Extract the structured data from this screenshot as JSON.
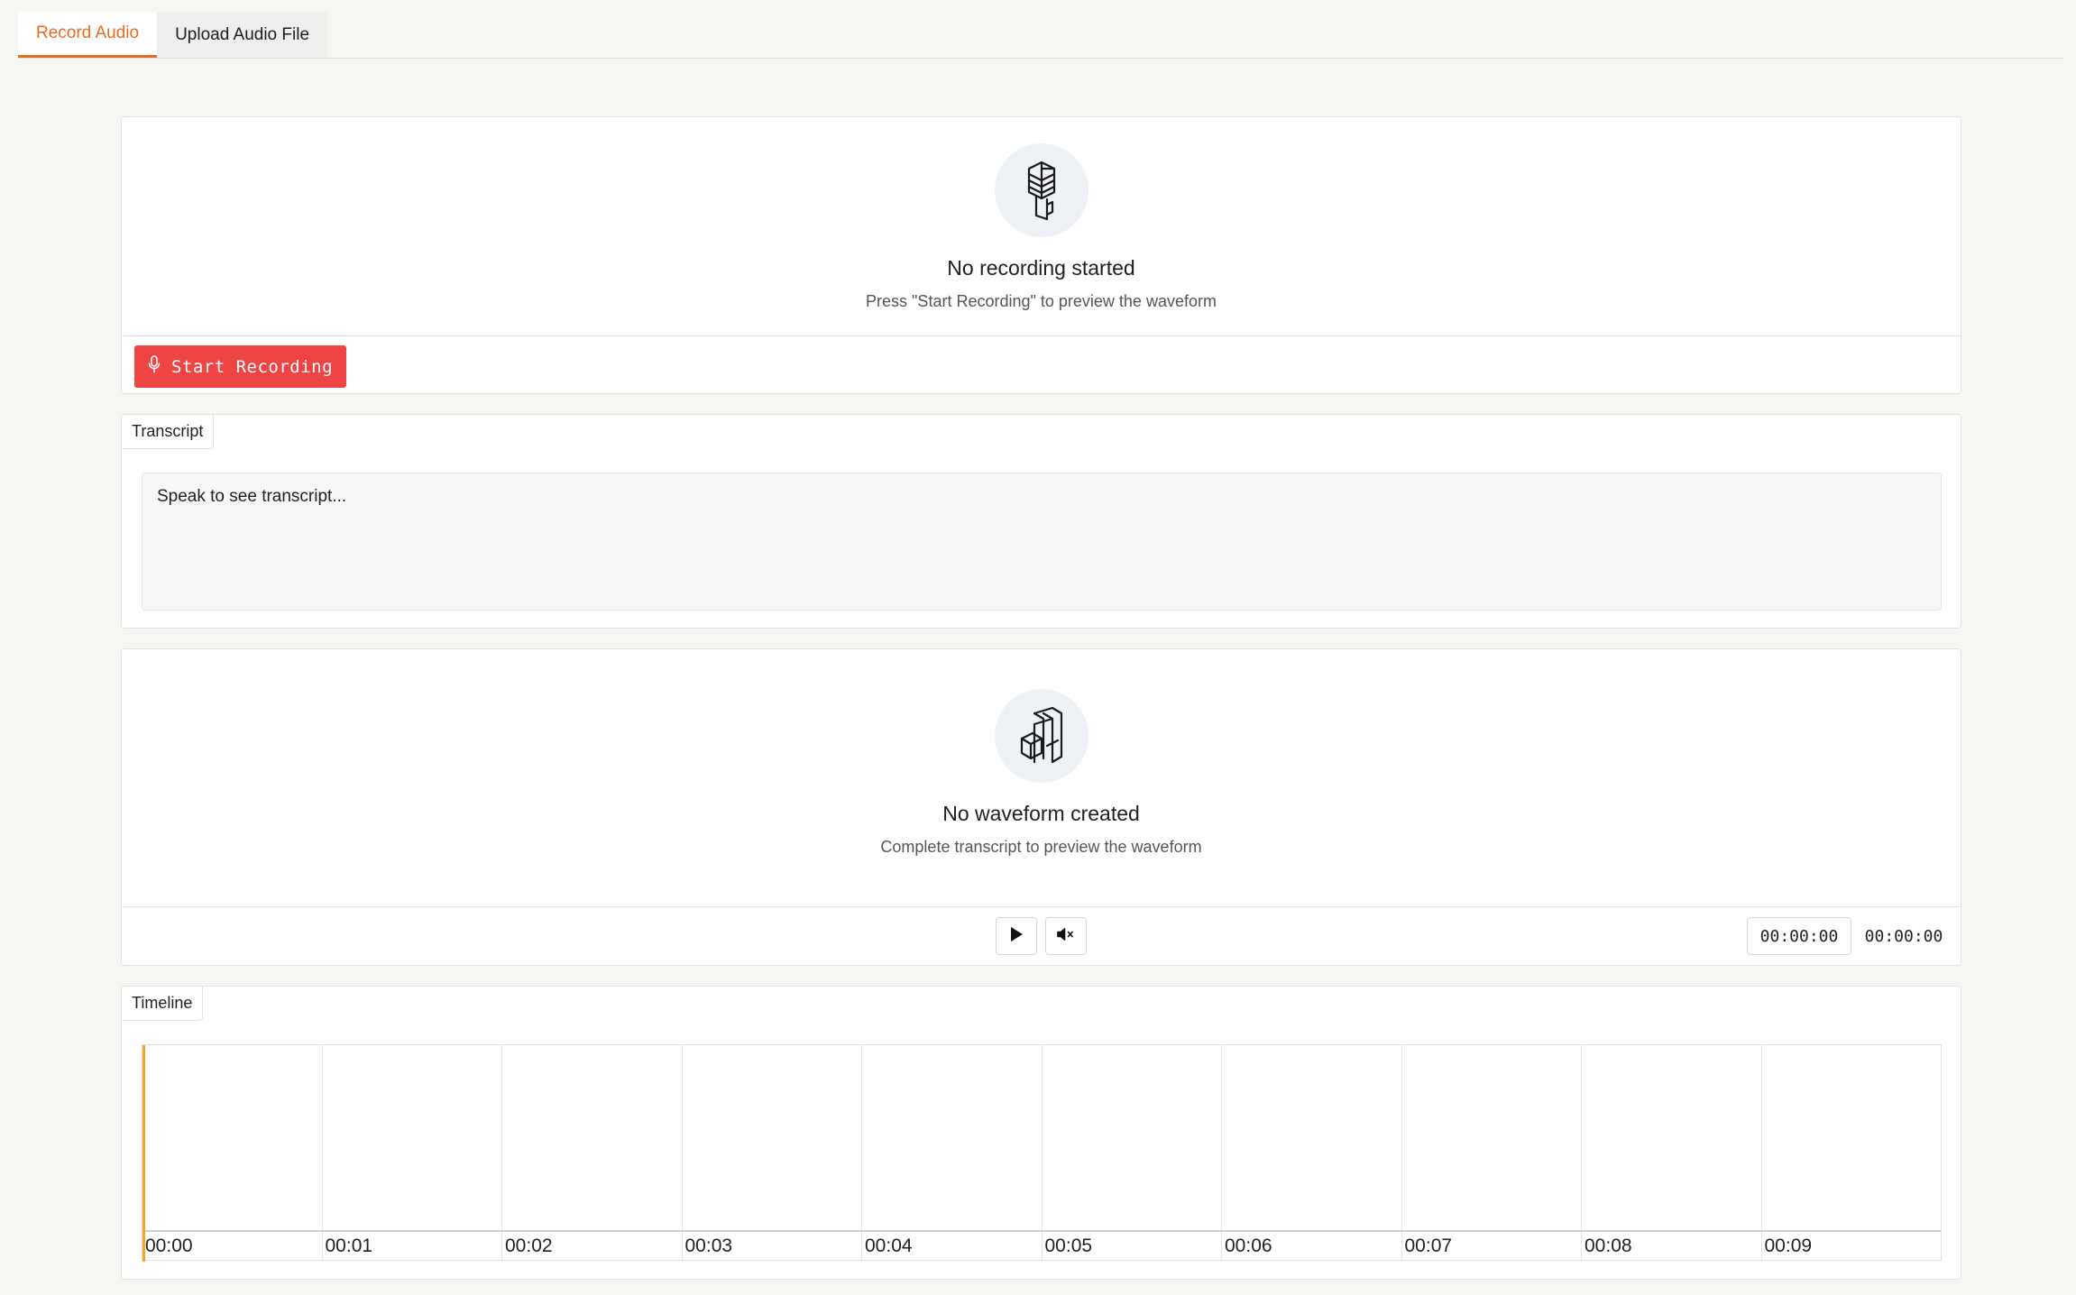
{
  "tabs": [
    {
      "label": "Record Audio",
      "active": true
    },
    {
      "label": "Upload Audio File",
      "active": false
    }
  ],
  "recording": {
    "icon": "microphone-icon",
    "title": "No recording started",
    "subtitle": "Press \"Start Recording\" to preview the waveform",
    "start_button": "Start Recording"
  },
  "transcript": {
    "label": "Transcript",
    "placeholder": "Speak to see transcript..."
  },
  "waveform": {
    "icon": "music-icon",
    "title": "No waveform created",
    "subtitle": "Complete transcript to preview the waveform",
    "current_time": "00:00:00",
    "total_time": "00:00:00"
  },
  "timeline": {
    "label": "Timeline",
    "ticks": [
      "00:00",
      "00:01",
      "00:02",
      "00:03",
      "00:04",
      "00:05",
      "00:06",
      "00:07",
      "00:08",
      "00:09"
    ]
  },
  "colors": {
    "accent": "#e86a1f",
    "record_button": "#ef4444",
    "playhead": "#f5a623"
  }
}
